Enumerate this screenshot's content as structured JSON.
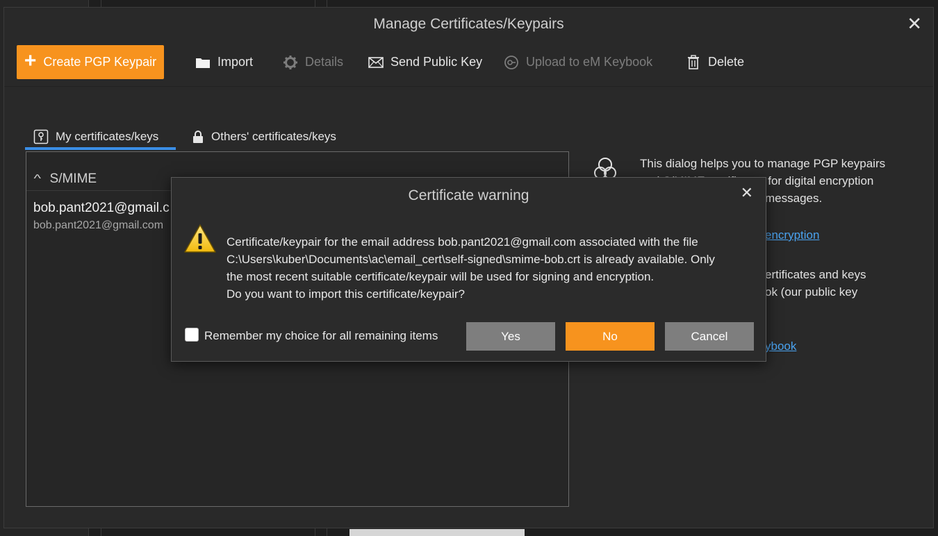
{
  "main_dialog": {
    "title": "Manage Certificates/Keypairs",
    "close_glyph": "✕",
    "toolbar": {
      "create_label": "Create PGP Keypair",
      "import_label": "Import",
      "details_label": "Details",
      "send_label": "Send Public Key",
      "upload_label": "Upload to eM Keybook",
      "delete_label": "Delete"
    },
    "tabs": [
      {
        "label": "My certificates/keys",
        "icon": "key-icon",
        "active": true
      },
      {
        "label": "Others' certificates/keys",
        "icon": "lock-icon",
        "active": false
      }
    ],
    "group": {
      "caret": "^",
      "title": "S/MIME"
    },
    "certificate": {
      "name": "bob.pant2021@gmail.c",
      "email": "bob.pant2021@gmail.com"
    },
    "info": {
      "line1": "This dialog helps you to manage PGP keypairs",
      "line2": "and S/MIME certificates for digital encryption",
      "line3": "messages.",
      "link1": "encryption",
      "line4": "ertificates and keys",
      "line5": "ok (our public key",
      "link2": "ybook"
    }
  },
  "warning_dialog": {
    "title": "Certificate warning",
    "close_glyph": "✕",
    "message_lines": [
      "Certificate/keypair for the email address bob.pant2021@gmail.com associated with the file",
      "C:\\Users\\kuber\\Documents\\ac\\email_cert\\self-signed\\smime-bob.crt is already available. Only",
      "the most recent suitable certificate/keypair will be used for signing and encryption.",
      "Do you want to import this certificate/keypair?"
    ],
    "remember_label": "Remember my choice for all remaining items",
    "yes_label": "Yes",
    "no_label": "No",
    "cancel_label": "Cancel"
  },
  "colors": {
    "accent_orange": "#f7931e",
    "tab_blue": "#3a8ee6",
    "link_blue": "#4aa3f0",
    "button_grey": "#7e7e7e"
  }
}
